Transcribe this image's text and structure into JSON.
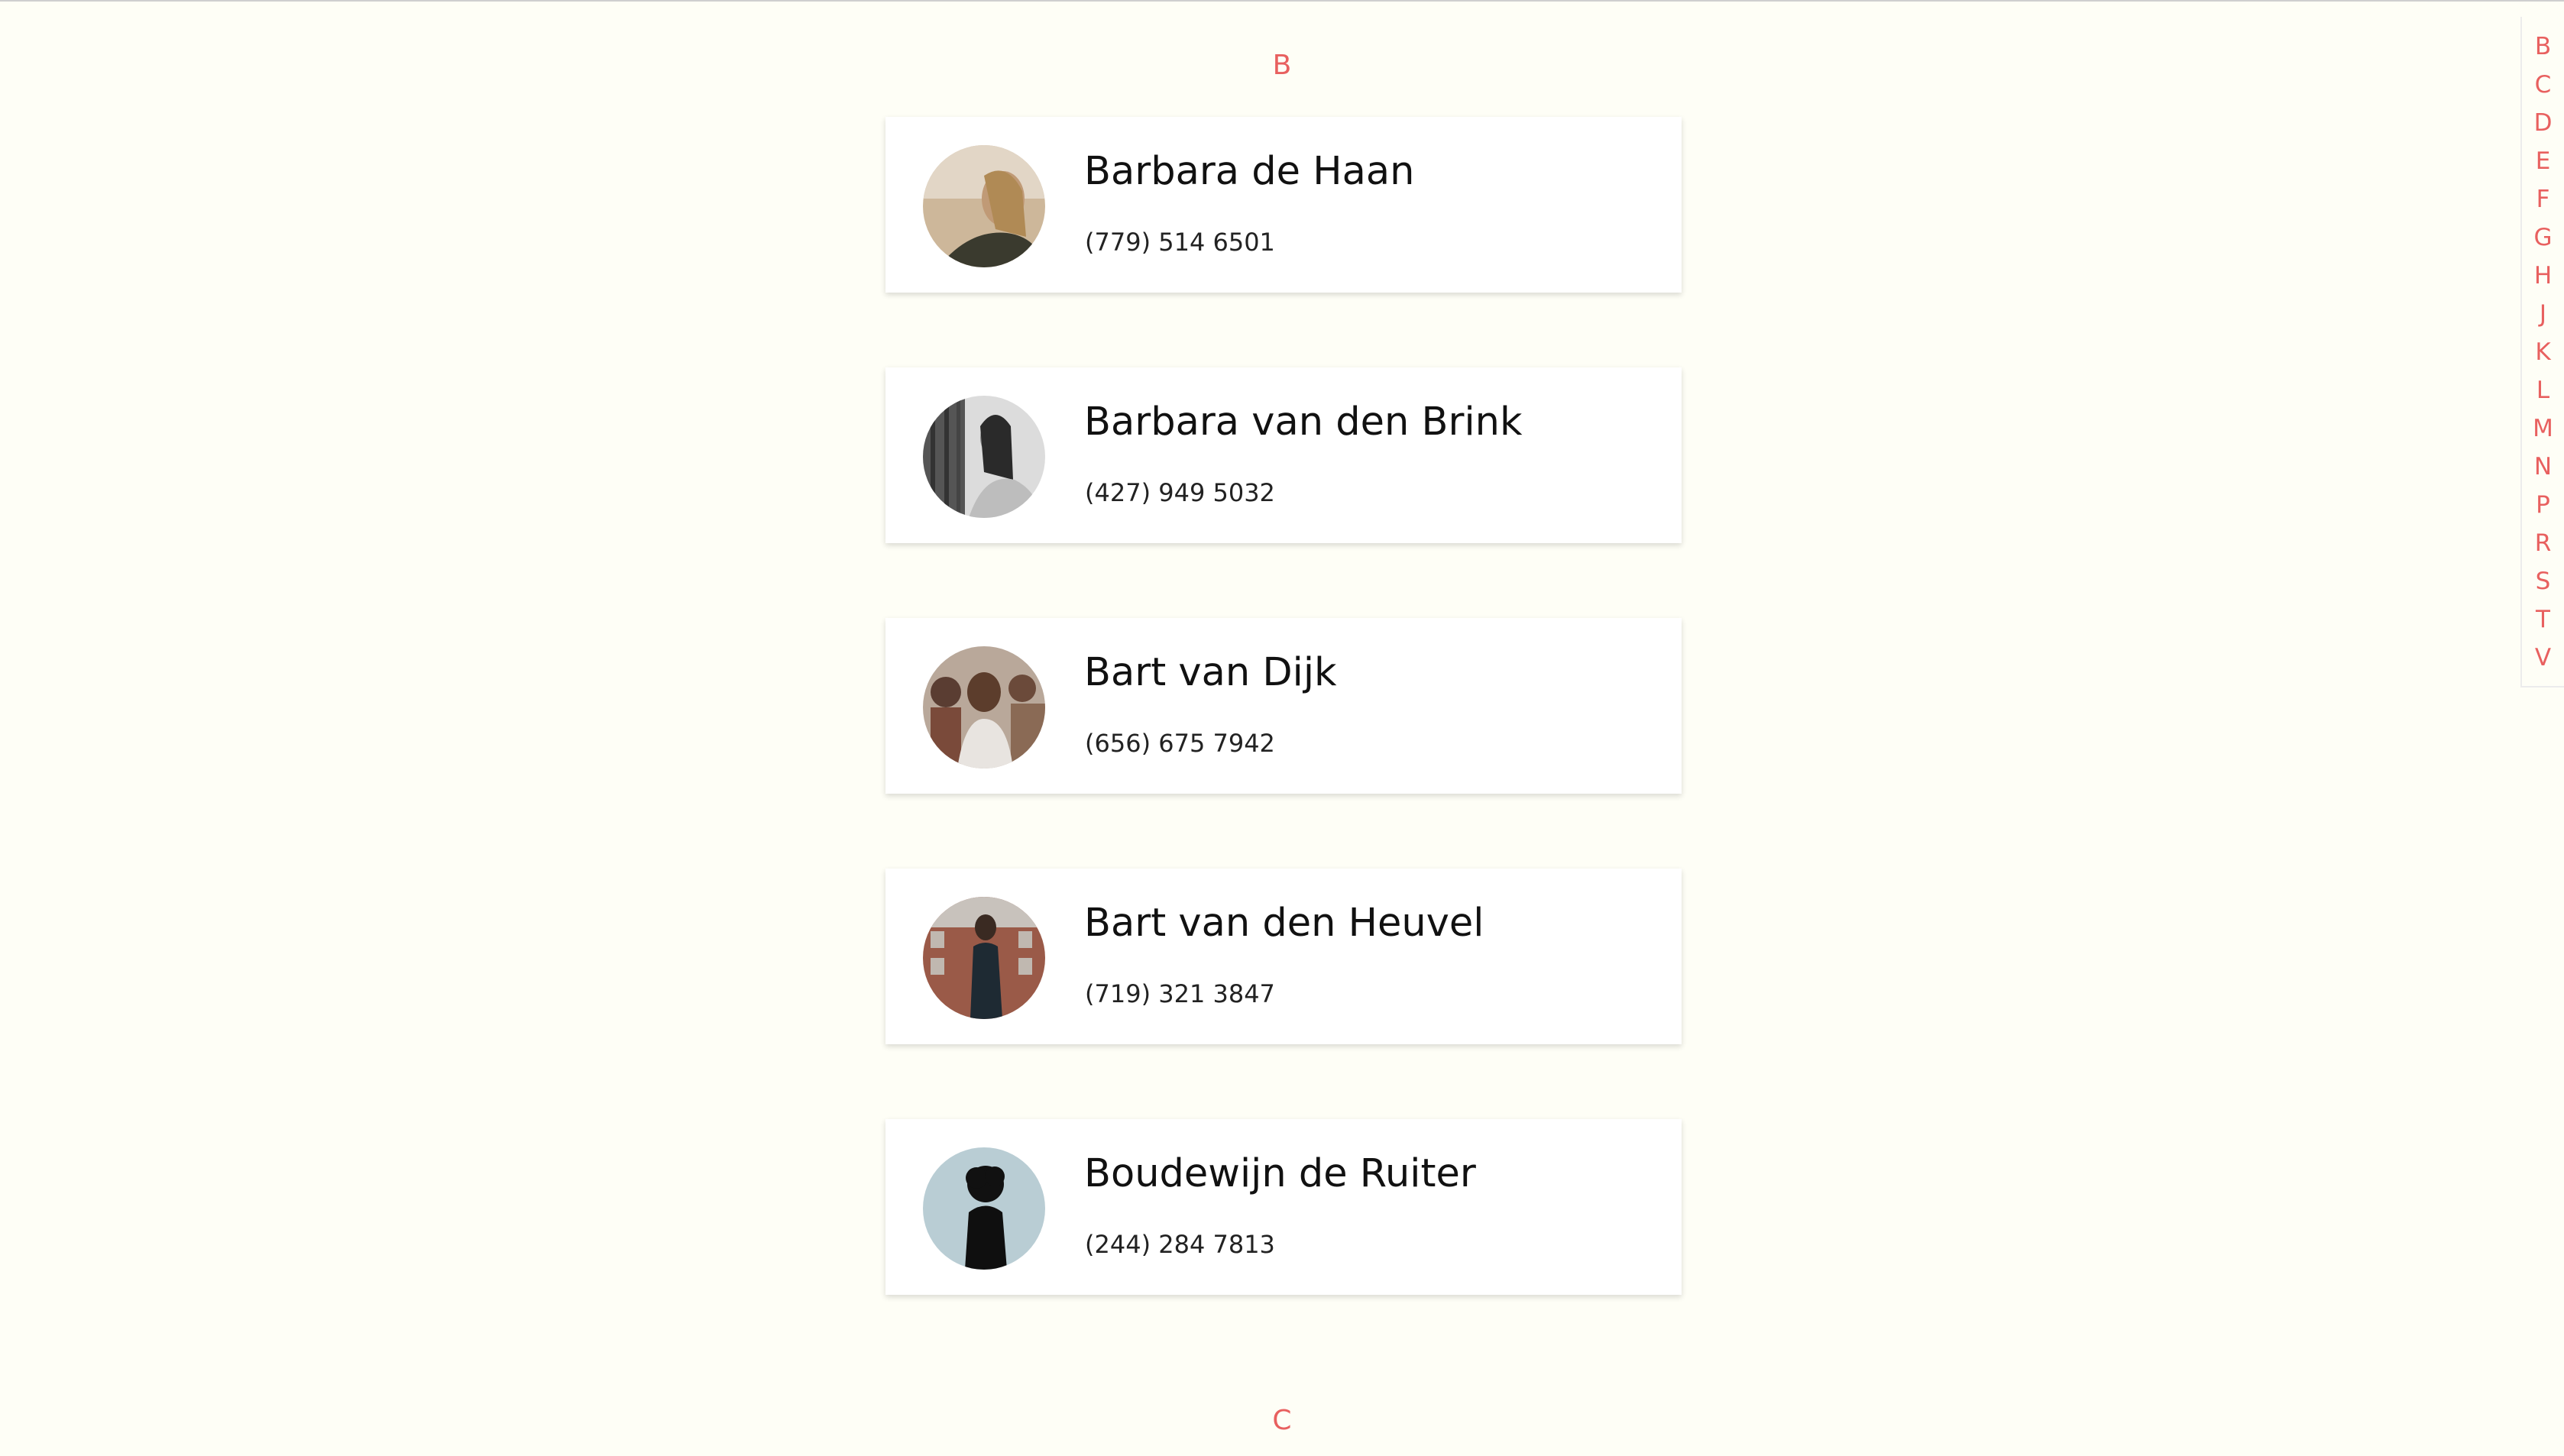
{
  "sections": [
    {
      "letter": "B",
      "contacts": [
        {
          "name": "Barbara de Haan",
          "phone": "(779) 514 6501"
        },
        {
          "name": "Barbara van den Brink",
          "phone": "(427) 949 5032"
        },
        {
          "name": "Bart van Dijk",
          "phone": "(656) 675 7942"
        },
        {
          "name": "Bart van den Heuvel",
          "phone": "(719) 321 3847"
        },
        {
          "name": "Boudewijn de Ruiter",
          "phone": "(244) 284 7813"
        }
      ]
    },
    {
      "letter": "C",
      "contacts": []
    }
  ],
  "alphabet_index": [
    "B",
    "C",
    "D",
    "E",
    "F",
    "G",
    "H",
    "J",
    "K",
    "L",
    "M",
    "N",
    "P",
    "R",
    "S",
    "T",
    "V"
  ],
  "colors": {
    "accent": "#e8605f",
    "background": "#fefef6",
    "card": "#ffffff"
  }
}
